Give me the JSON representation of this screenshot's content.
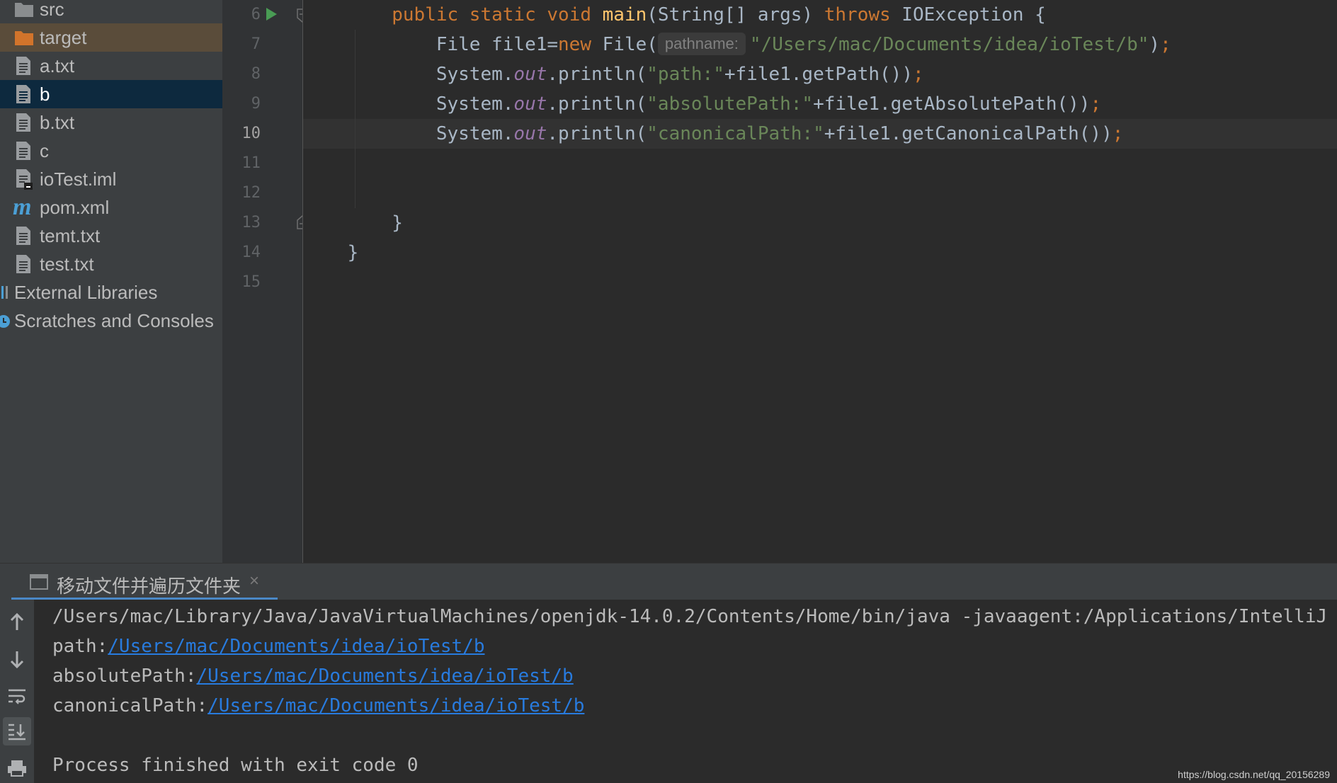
{
  "project_tree": {
    "items": [
      {
        "label": "src",
        "icon": "folder-icon"
      },
      {
        "label": "target",
        "icon": "folder-orange-icon"
      },
      {
        "label": "a.txt",
        "icon": "text-file-icon"
      },
      {
        "label": "b",
        "icon": "text-file-icon"
      },
      {
        "label": "b.txt",
        "icon": "text-file-icon"
      },
      {
        "label": "c",
        "icon": "text-file-icon"
      },
      {
        "label": "ioTest.iml",
        "icon": "iml-file-icon"
      },
      {
        "label": "pom.xml",
        "icon": "maven-icon"
      },
      {
        "label": "temt.txt",
        "icon": "text-file-icon"
      },
      {
        "label": "test.txt",
        "icon": "text-file-icon"
      },
      {
        "label": "External Libraries",
        "icon": "libraries-icon"
      },
      {
        "label": "Scratches and Consoles",
        "icon": "scratches-icon"
      }
    ],
    "selected": "b",
    "highlighted": "target"
  },
  "editor": {
    "line_numbers": [
      "6",
      "7",
      "8",
      "9",
      "10",
      "11",
      "12",
      "13",
      "14",
      "15"
    ],
    "current_line": "10",
    "parameter_hint": "pathname:",
    "lines": {
      "l6": {
        "kw1": "public static void ",
        "fn": "main",
        "p1": "(String[] args) ",
        "kw2": "throws",
        "p2": " IOException {"
      },
      "l7": {
        "p1": "File file1=",
        "kw1": "new",
        "p2": " File(",
        "str": "\"/Users/mac/Documents/idea/ioTest/b\"",
        "p3": ")",
        "semi": ";"
      },
      "l8": {
        "p1": "System.",
        "it": "out",
        "p2": ".println(",
        "str": "\"path:\"",
        "p3": "+file1.getPath())",
        "semi": ";"
      },
      "l9": {
        "p1": "System.",
        "it": "out",
        "p2": ".println(",
        "str": "\"absolutePath:\"",
        "p3": "+file1.getAbsolutePath())",
        "semi": ";"
      },
      "l10": {
        "p1": "System.",
        "it": "out",
        "p2": ".println(",
        "str": "\"canonicalPath:\"",
        "p3": "+file1.getCanonicalPath())",
        "semi": ";"
      },
      "l13": "}",
      "l14": "}"
    }
  },
  "console": {
    "tab_title": "移动文件并遍历文件夹",
    "lines": {
      "cmd": "/Users/mac/Library/Java/JavaVirtualMachines/openjdk-14.0.2/Contents/Home/bin/java -javaagent:/Applications/IntelliJ",
      "path_label": "path:",
      "path_link": "/Users/mac/Documents/idea/ioTest/b",
      "abs_label": "absolutePath:",
      "abs_link": "/Users/mac/Documents/idea/ioTest/b",
      "can_label": "canonicalPath:",
      "can_link": "/Users/mac/Documents/idea/ioTest/b",
      "exit": "Process finished with exit code 0"
    }
  },
  "watermark": "https://blog.csdn.net/qq_20156289",
  "colors": {
    "keyword": "#cc7832",
    "function": "#ffc66d",
    "string": "#6a8759",
    "link": "#287bde",
    "selection": "#0d293e"
  }
}
